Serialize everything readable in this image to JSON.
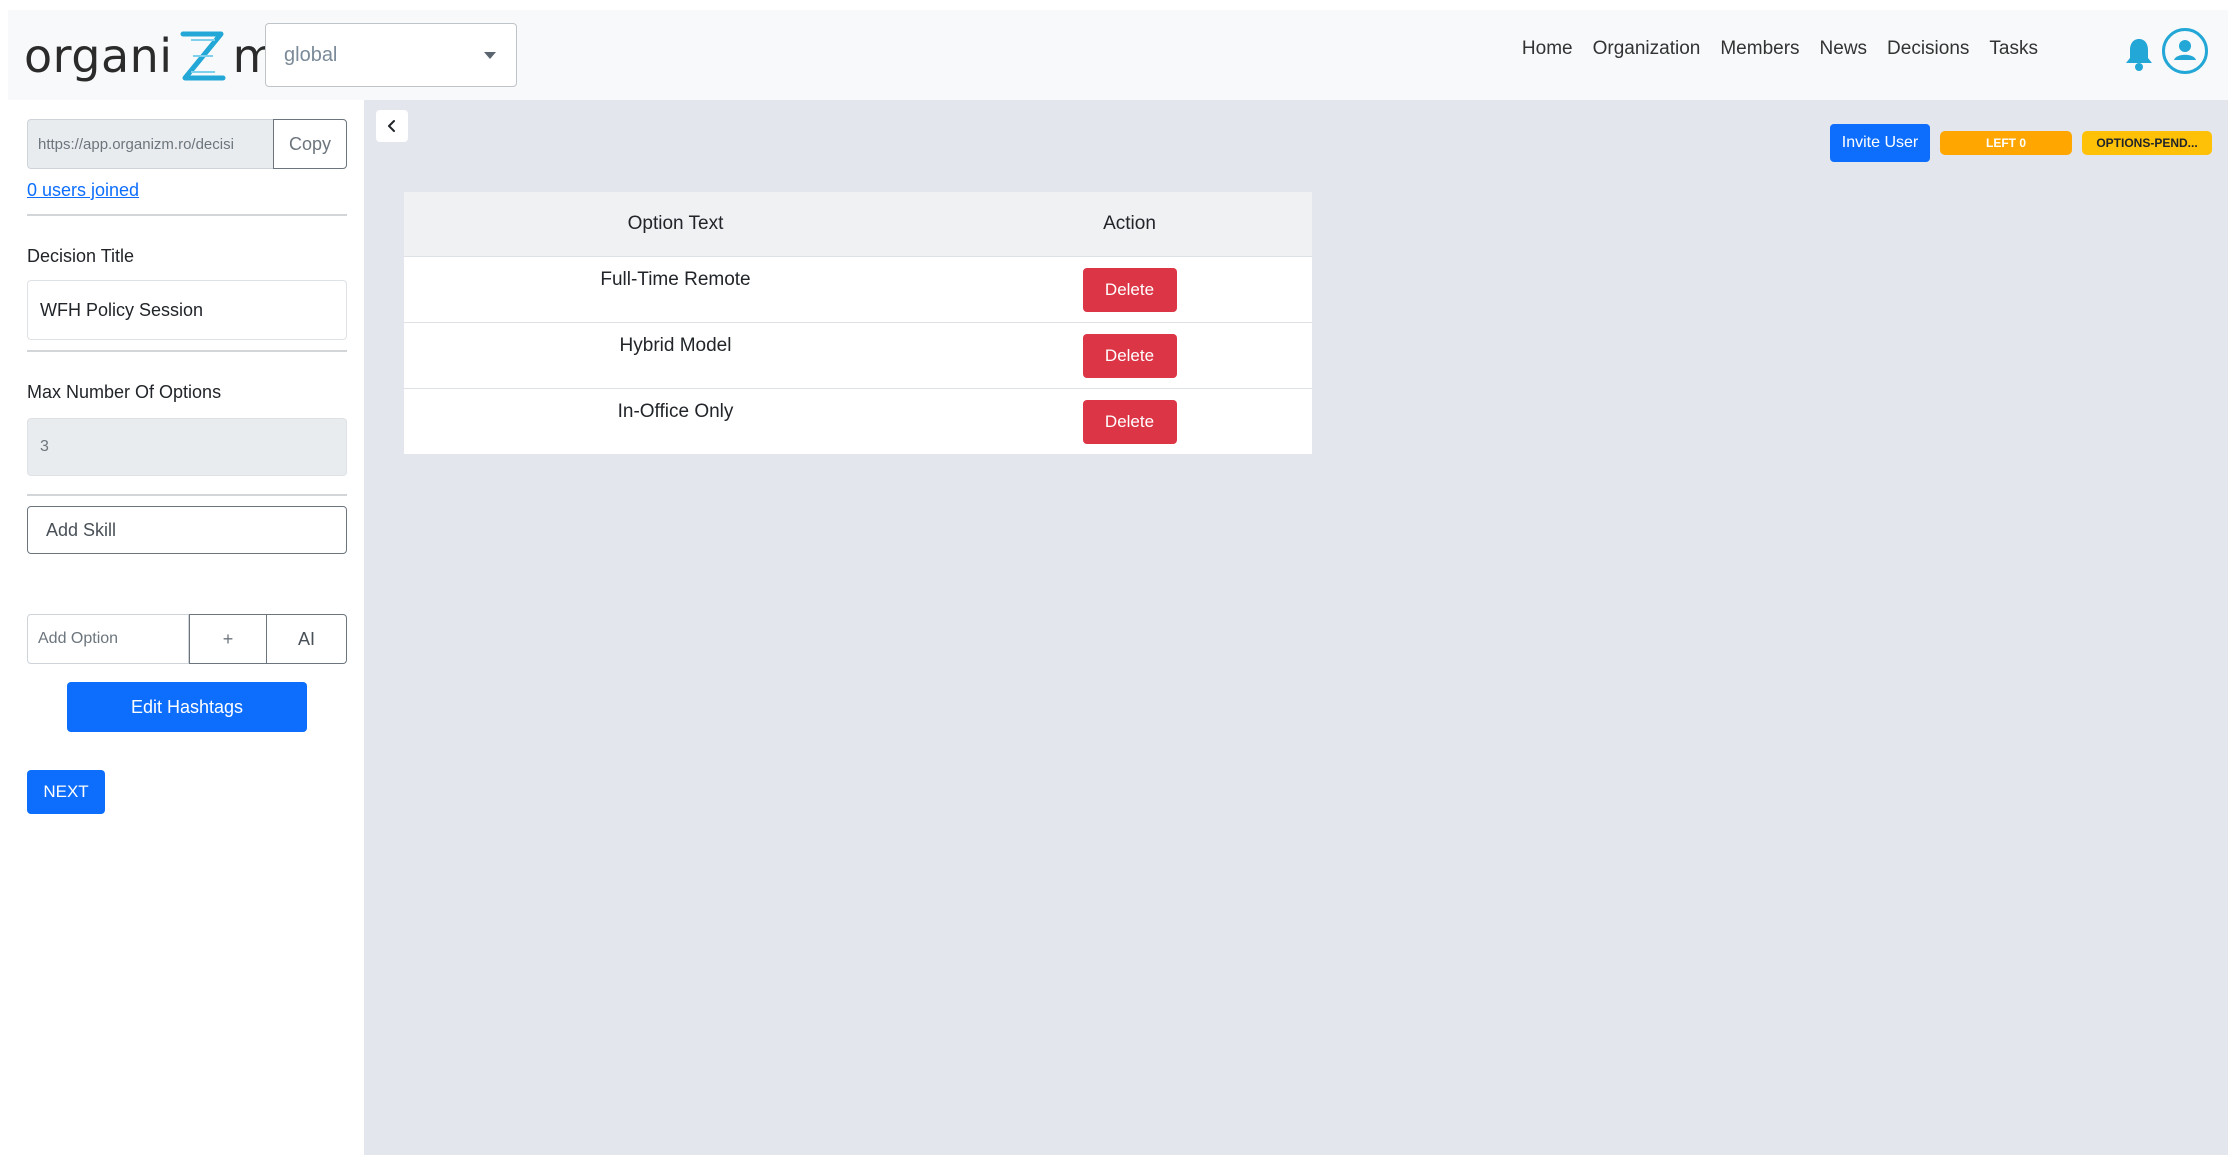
{
  "header": {
    "logo_text_left": "organi",
    "logo_text_right": "m",
    "org_select_value": "global",
    "nav_items": [
      "Home",
      "Organization",
      "Members",
      "News",
      "Decisions",
      "Tasks"
    ]
  },
  "sidebar": {
    "share_url": "https://app.organizm.ro/decisi",
    "copy_label": "Copy",
    "users_joined": "0 users joined",
    "decision_title_label": "Decision Title",
    "decision_title_value": "WFH Policy Session",
    "max_options_label": "Max Number Of Options",
    "max_options_value": "3",
    "add_skill_placeholder": "Add Skill",
    "add_option_placeholder": "Add Option",
    "add_option_plus": "+",
    "add_option_ai": "AI",
    "edit_hashtags_label": "Edit Hashtags",
    "next_label": "NEXT"
  },
  "main": {
    "invite_label": "Invite User",
    "left_badge": "LEFT 0",
    "status_badge": "OPTIONS-PEND...",
    "table": {
      "headers": [
        "Option Text",
        "Action"
      ],
      "rows": [
        {
          "text": "Full-Time Remote",
          "action": "Delete"
        },
        {
          "text": "Hybrid Model",
          "action": "Delete"
        },
        {
          "text": "In-Office Only",
          "action": "Delete"
        }
      ]
    }
  },
  "colors": {
    "primary": "#0d6efd",
    "danger": "#dc3545",
    "warning": "#ffc107",
    "accent": "#22a7d6"
  },
  "icons": {
    "logo_mark": "z-double-helix-icon",
    "dropdown": "caret-down-icon",
    "notifications": "bell-icon",
    "profile": "user-circle-icon",
    "collapse": "chevron-left-icon"
  }
}
